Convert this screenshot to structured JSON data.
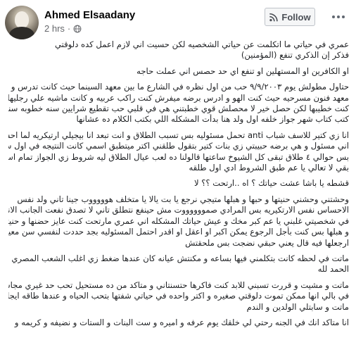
{
  "post": {
    "author": "Ahmed Elsaadany",
    "time": "2 hrs",
    "separator": "·",
    "follow_label": "Follow",
    "paragraphs": [
      [
        "عمري في حياتي ما اتكلمت عن حياتي الشخصيه لكن حسيت اني لازم اعمل كده دلوقتي",
        "فذكر إن الذكري تنفع (المؤمنين)"
      ],
      [
        "او الكافرين او المستهلين او تنفع اي حد حصس اني عملت حاجه"
      ],
      [
        "حتاول مطولش يوم ٩/٩/٢٠٠٣ حب من اول نظره في الشارع ما بين معهد السينما حيث كانت تدرس و",
        "معهد فنون مسرحيه حيث كنت الهو و ادرس برضه ميفرش كنت راكب عربيه و كانت ماشيه علي رجليها",
        "كنت خطيبها لكن حصل خير لا محصلش قوي خطبتني هي في قلبي حب تقطيع شرايين سنه خطوبه سنه",
        "كتب كتاب شهر جواز خلفه اول ولد هنا بدأت المشكله اللي بكتب الكلام ده عشانها"
      ],
      [
        "انا زي كتير للاسف شباب anti تحمل مسئوليه بس تسبب الطلاق و انت تبعد انا بيجيلي ارتيكريه لما احس",
        "اني مسئول و هي برضه حبيبتي زي بنات كتير بتقول طلقني اكتر ميتطبق اسمي كانت النتيجه في اول سنه",
        "بس حوالي ٤ طلاق تبقى كل الشيوخ ساعتها قالولنا ده لعب عيال الطلاق ليه شروط زي الجواز تمام اسكت",
        "بقي لا تعالي يا عم طبق الشروط ادي اول طلقه"
      ],
      [
        "قشطه يا باشا عشت حياتك ؟ اه ..ارتحت ؟؟ لا"
      ],
      [
        "وحشتني وحشني حنيتها و حبها و هبلها متيجي نرجع يا بت يالا يا متخلف هوووووب جينا تاني ولد نفس",
        "الاحساس نفس الارتكيريه بس المرادي صمووووووت مش حينفع نتطلق تاني لا تصدق نفعت الجانب الاناني",
        "في شخصيتي غلبني يا عم كبر مخك و عيش حياتك المشكله اني عمري مارتحت كنت عايز حضنها و حنيتها",
        "و هبلها بس كنت بأجل الرجوع يمكن اكبر او اعقل او اقدر احتمل المسئوليه بجد حددت لنفسي سن معين",
        "ارجعلها فيه قال يعني حبقي نضجت بس ملحقتش"
      ],
      [
        "ماتت في لحظه كانت بتكلمني فيها بساعه و مكنتش عيانه كان عندها ضغط زي اغلب الشعب المصري",
        "الحمد لله"
      ],
      [
        "ماتت و مشيت و قررت تسبني للابد كنت فاكرها حتسنتاني و متاكد من ده مستحيل تحب حد غيري مجاش",
        "في بالي انها ممكن تموت دلوقتي صغيره و اكتر واحده في حياتي شفتها بتحب الحياه و عندها طاقه ايجابيه",
        "ماتت و سابتلي الولدين و الندم"
      ],
      [
        "انا متاكد انك في الجنه رحتي لي خلقك يوم عرفه و اميره و ست البنات و الستات و نضيفه و كريمه و"
      ]
    ]
  }
}
